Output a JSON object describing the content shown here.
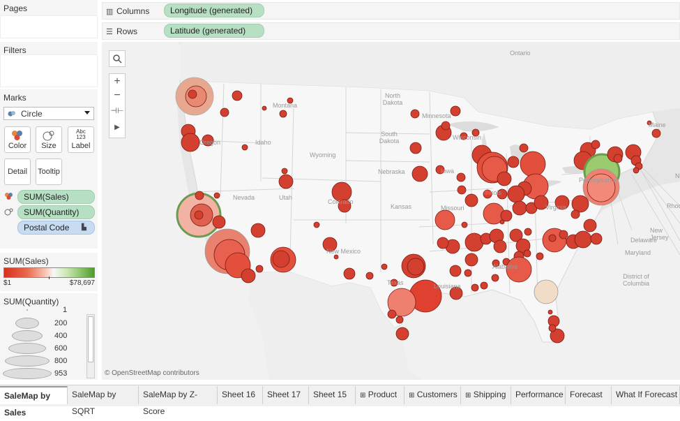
{
  "pages": {
    "title": "Pages"
  },
  "filters": {
    "title": "Filters"
  },
  "marks": {
    "title": "Marks",
    "mark_type": "Circle",
    "buttons": {
      "color": "Color",
      "size": "Size",
      "label": "Label",
      "detail": "Detail",
      "tooltip": "Tooltip",
      "label_icon": "Abc 123"
    },
    "fields": [
      {
        "label": "SUM(Sales)",
        "color": "#b7dfc3"
      },
      {
        "label": "SUM(Quantity)",
        "color": "#b7dfc3"
      },
      {
        "label": "Postal Code",
        "color": "#c7dcf1"
      }
    ]
  },
  "sales_legend": {
    "title": "SUM(Sales)",
    "min": "$1",
    "max": "$78,697",
    "colors": {
      "low": "#d7301f",
      "mid": "#f7f7f7",
      "high": "#4d9b2e"
    }
  },
  "quantity_legend": {
    "title": "SUM(Quantity)",
    "items": [
      "1",
      "200",
      "400",
      "600",
      "800",
      "953"
    ]
  },
  "columns": {
    "label": "Columns",
    "pill": "Longitude (generated)"
  },
  "rows": {
    "label": "Rows",
    "pill": "Latitude (generated)"
  },
  "map": {
    "attribution": "© OpenStreetMap contributors",
    "labels": [
      {
        "text": "Ontario"
      },
      {
        "text": "Montana"
      },
      {
        "text": "North Dakota"
      },
      {
        "text": "Minnesota"
      },
      {
        "text": "South Dakota"
      },
      {
        "text": "Wisconsin"
      },
      {
        "text": "Idaho"
      },
      {
        "text": "Wyoming"
      },
      {
        "text": "Oregon"
      },
      {
        "text": "Nebraska"
      },
      {
        "text": "Iowa"
      },
      {
        "text": "Nevada"
      },
      {
        "text": "Utah"
      },
      {
        "text": "Colorado"
      },
      {
        "text": "Kansas"
      },
      {
        "text": "Missouri"
      },
      {
        "text": "Illinois"
      },
      {
        "text": "Pennsylvania"
      },
      {
        "text": "Virginia"
      },
      {
        "text": "New Mexico"
      },
      {
        "text": "Texas"
      },
      {
        "text": "Louisiana"
      },
      {
        "text": "Alabama"
      },
      {
        "text": "Maine"
      },
      {
        "text": "New Jersey"
      },
      {
        "text": "Delaware"
      },
      {
        "text": "Maryland"
      },
      {
        "text": "District of Columbia"
      },
      {
        "text": "Rhode"
      },
      {
        "text": "N"
      }
    ]
  },
  "tabs": [
    {
      "label": "SaleMap by Sales",
      "active": true
    },
    {
      "label": "SaleMap by SQRT"
    },
    {
      "label": "SaleMap by Z-Score"
    },
    {
      "label": "Sheet 16"
    },
    {
      "label": "Sheet 17"
    },
    {
      "label": "Sheet 15"
    },
    {
      "label": "Product",
      "icon": "grid-icon"
    },
    {
      "label": "Customers",
      "icon": "grid-icon"
    },
    {
      "label": "Shipping",
      "icon": "grid-icon"
    },
    {
      "label": "Performance"
    },
    {
      "label": "Forecast"
    },
    {
      "label": "What If Forecast"
    }
  ]
}
